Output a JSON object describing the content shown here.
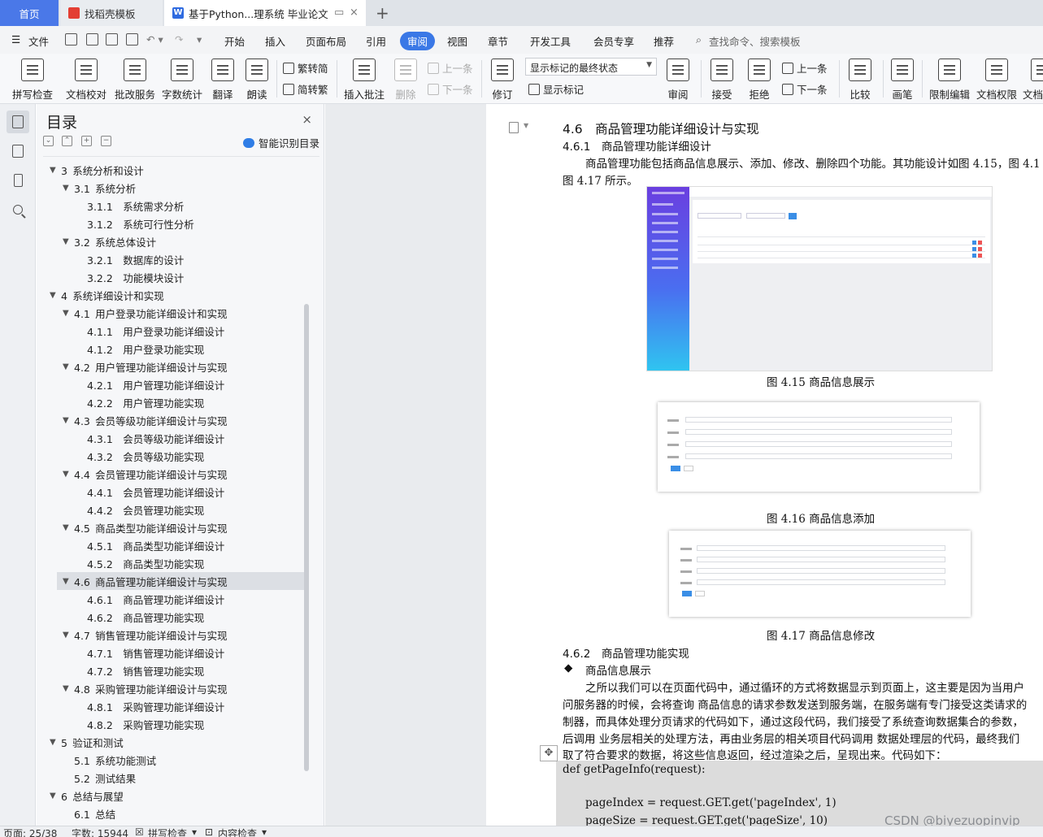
{
  "tabs": {
    "home": "首页",
    "template": "找稻壳模板",
    "document": "基于Python...理系统 毕业论文",
    "close": "×",
    "add": "+"
  },
  "menu": {
    "file": "文件",
    "items": [
      "开始",
      "插入",
      "页面布局",
      "引用",
      "审阅",
      "视图",
      "章节",
      "开发工具",
      "会员专享",
      "推荐"
    ],
    "search": "查找命令、搜索模板"
  },
  "ribbon": {
    "spell": "拼写检查",
    "proof": "文档校对",
    "batch": "批改服务",
    "wordcount": "字数统计",
    "translate": "翻译",
    "read": "朗读",
    "trad": "繁转简",
    "simp": "简转繁",
    "insert_comment": "插入批注",
    "delete": "删除",
    "prev": "上一条",
    "next": "下一条",
    "revise": "修订",
    "markup_state": "显示标记的最终状态",
    "show_markup": "显示标记",
    "review": "审阅",
    "accept": "接受",
    "reject": "拒绝",
    "prev2": "上一条",
    "next2": "下一条",
    "compare": "比较",
    "pen": "画笔",
    "restrict": "限制编辑",
    "rights": "文档权限",
    "more": "文档"
  },
  "toc": {
    "title": "目录",
    "close": "×",
    "smart": "智能识别目录",
    "items": [
      {
        "num": "3",
        "text": "系统分析和设计",
        "level": 1,
        "arrow": true
      },
      {
        "num": "3.1",
        "text": "系统分析",
        "level": 2,
        "arrow": true
      },
      {
        "num": "3.1.1",
        "text": "系统需求分析",
        "level": 3
      },
      {
        "num": "3.1.2",
        "text": "系统可行性分析",
        "level": 3
      },
      {
        "num": "3.2",
        "text": "系统总体设计",
        "level": 2,
        "arrow": true
      },
      {
        "num": "3.2.1",
        "text": "数据库的设计",
        "level": 3
      },
      {
        "num": "3.2.2",
        "text": "功能模块设计",
        "level": 3
      },
      {
        "num": "4",
        "text": "系统详细设计和实现",
        "level": 1,
        "arrow": true
      },
      {
        "num": "4.1",
        "text": "用户登录功能详细设计和实现",
        "level": 2,
        "arrow": true
      },
      {
        "num": "4.1.1",
        "text": "用户登录功能详细设计",
        "level": 3
      },
      {
        "num": "4.1.2",
        "text": "用户登录功能实现",
        "level": 3
      },
      {
        "num": "4.2",
        "text": "用户管理功能详细设计与实现",
        "level": 2,
        "arrow": true
      },
      {
        "num": "4.2.1",
        "text": "用户管理功能详细设计",
        "level": 3
      },
      {
        "num": "4.2.2",
        "text": "用户管理功能实现",
        "level": 3
      },
      {
        "num": "4.3",
        "text": "会员等级功能详细设计与实现",
        "level": 2,
        "arrow": true
      },
      {
        "num": "4.3.1",
        "text": "会员等级功能详细设计",
        "level": 3
      },
      {
        "num": "4.3.2",
        "text": "会员等级功能实现",
        "level": 3
      },
      {
        "num": "4.4",
        "text": "会员管理功能详细设计与实现",
        "level": 2,
        "arrow": true
      },
      {
        "num": "4.4.1",
        "text": "会员管理功能详细设计",
        "level": 3
      },
      {
        "num": "4.4.2",
        "text": "会员管理功能实现",
        "level": 3
      },
      {
        "num": "4.5",
        "text": "商品类型功能详细设计与实现",
        "level": 2,
        "arrow": true
      },
      {
        "num": "4.5.1",
        "text": "商品类型功能详细设计",
        "level": 3
      },
      {
        "num": "4.5.2",
        "text": "商品类型功能实现",
        "level": 3
      },
      {
        "num": "4.6",
        "text": "商品管理功能详细设计与实现",
        "level": 2,
        "arrow": true,
        "selected": true
      },
      {
        "num": "4.6.1",
        "text": "商品管理功能详细设计",
        "level": 3
      },
      {
        "num": "4.6.2",
        "text": "商品管理功能实现",
        "level": 3
      },
      {
        "num": "4.7",
        "text": "销售管理功能详细设计与实现",
        "level": 2,
        "arrow": true
      },
      {
        "num": "4.7.1",
        "text": "销售管理功能详细设计",
        "level": 3
      },
      {
        "num": "4.7.2",
        "text": "销售管理功能实现",
        "level": 3
      },
      {
        "num": "4.8",
        "text": "采购管理功能详细设计与实现",
        "level": 2,
        "arrow": true
      },
      {
        "num": "4.8.1",
        "text": "采购管理功能详细设计",
        "level": 3
      },
      {
        "num": "4.8.2",
        "text": "采购管理功能实现",
        "level": 3
      },
      {
        "num": "5",
        "text": "验证和测试",
        "level": 1,
        "arrow": true
      },
      {
        "num": "5.1",
        "text": "系统功能测试",
        "level": 2
      },
      {
        "num": "5.2",
        "text": "测试结果",
        "level": 2
      },
      {
        "num": "6",
        "text": "总结与展望",
        "level": 1,
        "arrow": true
      },
      {
        "num": "6.1",
        "text": "总结",
        "level": 2
      }
    ]
  },
  "document": {
    "h_4_6": "4.6　商品管理功能详细设计与实现",
    "h_4_6_1": "4.6.1　商品管理功能详细设计",
    "p1_line1": "商品管理功能包括商品信息展示、添加、修改、删除四个功能。其功能设计如图 4.15，图 4.1",
    "p1_line2": "图 4.17 所示。",
    "fig1_caption": "图 4.15 商品信息展示",
    "fig2_caption": "图 4.16 商品信息添加",
    "fig3_caption": "图 4.17 商品信息修改",
    "h_4_6_2": "4.6.2　商品管理功能实现",
    "bullet": "◆",
    "bullet_text": "商品信息展示",
    "p2_line1": "之所以我们可以在页面代码中，通过循环的方式将数据显示到页面上，这主要是因为当用户",
    "p2_line2": "问服务器的时候，会将查询 商品信息的请求参数发送到服务端，在服务端有专门接受这类请求的",
    "p2_line3": "制器，而具体处理分页请求的代码如下，通过这段代码，我们接受了系统查询数据集合的参数，",
    "p2_line4": "后调用 业务层相关的处理方法，再由业务层的相关项目代码调用 数据处理层的代码，最终我们",
    "p2_line5": "取了符合要求的数据，将这些信息返回，经过渲染之后，呈现出来。代码如下：",
    "code_line1": "def getPageInfo(request):",
    "code_line2": "pageIndex = request.GET.get('pageIndex', 1)",
    "code_line3": "pageSize = request.GET.get('pageSize', 10)"
  },
  "watermark": "CSDN @biyezuopinvip",
  "status": {
    "page": "页面: 25/38",
    "words": "字数: 15944",
    "spell": "拼写检查",
    "content": "内容检查"
  }
}
